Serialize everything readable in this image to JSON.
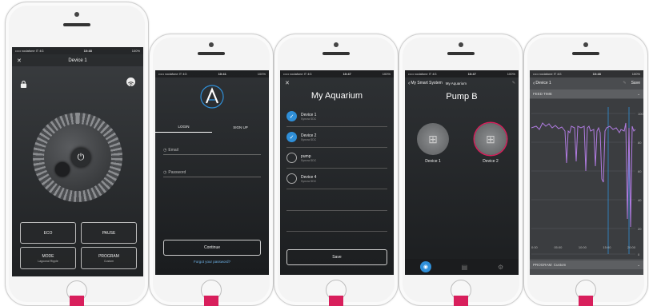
{
  "phone1": {
    "status": {
      "carrier": "••••• vodafone IT  4G",
      "time": "10:48",
      "battery": "100%"
    },
    "nav": {
      "close": "✕",
      "title": "Device 1"
    },
    "icons": {
      "lock": "lock-icon",
      "wifi": "wifi-icon",
      "power": "power-icon"
    },
    "buttons": [
      {
        "label": "ECO",
        "sub": ""
      },
      {
        "label": "PAUSE",
        "sub": ""
      },
      {
        "label": "MODE",
        "sub": "Lagoonal Ripple"
      },
      {
        "label": "PROGRAM",
        "sub": "Custom"
      }
    ]
  },
  "phone2": {
    "status": {
      "carrier": "••••• vodafone IT  4G",
      "time": "10:41",
      "battery": "100%"
    },
    "tabs": {
      "login": "LOGIN",
      "signup": "SIGN UP"
    },
    "email_placeholder": "Email",
    "password_placeholder": "Password",
    "continue_label": "Continue",
    "forgot_label": "Forgot your password?"
  },
  "phone3": {
    "status": {
      "carrier": "••••• vodafone IT  4G",
      "time": "10:47",
      "battery": "100%"
    },
    "title": "My Aquarium",
    "devices": [
      {
        "name": "Device 1",
        "sub": "Syncra SDC",
        "checked": true
      },
      {
        "name": "Device 2",
        "sub": "Syncra SDC",
        "checked": true
      },
      {
        "name": "pump",
        "sub": "Syncra SDC",
        "checked": false
      },
      {
        "name": "Device 4",
        "sub": "Syncra SDC",
        "checked": false
      }
    ],
    "save_label": "Save"
  },
  "phone4": {
    "status": {
      "carrier": "••••• vodafone IT  4G",
      "time": "10:47",
      "battery": "100%"
    },
    "back_label": "My Smart System",
    "nav_title": "My Aquarium",
    "title": "Pump B",
    "pumps": [
      {
        "label": "Device 1"
      },
      {
        "label": "Device 2"
      }
    ]
  },
  "phone5": {
    "status": {
      "carrier": "••••• vodafone IT  4G",
      "time": "10:48",
      "battery": "100%"
    },
    "back_label": "Device 1",
    "save_label": "Save",
    "section_label": "FEED TIME",
    "footer_label": "PROGRAM: Custom",
    "y_ticks": [
      "100",
      "80",
      "60",
      "40",
      "20",
      "0"
    ],
    "x_ticks": [
      "0:00",
      "05:00",
      "10:00",
      "15:00",
      "20:00"
    ]
  }
}
